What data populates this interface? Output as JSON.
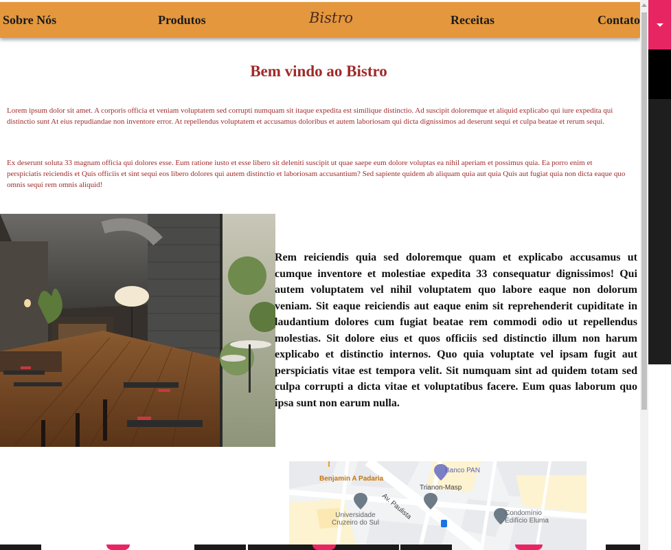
{
  "nav": {
    "items": [
      "Sobre Nós",
      "Produtos",
      "Receitas",
      "Contato"
    ],
    "logo": "Bistro"
  },
  "main": {
    "title": "Bem vindo ao Bistro",
    "paragraphs": [
      "Lorem ipsum dolor sit amet. A corporis officia et veniam voluptatem sed corrupti numquam sit itaque expedita est similique distinctio. Ad suscipit doloremque et aliquid explicabo qui iure expedita qui distinctio sunt At eius repudiandae non inventore error. At repellendus voluptatem et accusamus doloribus et autem laboriosam qui dicta dignissimos ad deserunt sequi et culpa beatae et rerum sequi.",
      "Ex deserunt soluta 33 magnam officia qui dolores esse. Eum ratione iusto et esse libero sit deleniti suscipit ut quae saepe eum dolore voluptas ea nihil aperiam et possimus quia. Ea porro enim et perspiciatis reiciendis et Quis officiis et sint sequi eos libero dolores qui autem distinctio et laboriosam accusantium? Sed sapiente quidem ab aliquam quia aut quia Quis aut fugiat quia non dicta eaque quo omnis sequi rem omnis aliquid!"
    ],
    "side_text": "Rem reiciendis quia sed doloremque quam et explicabo accusamus ut cumque inventore et molestiae expedita 33 consequatur dignissimos! Qui autem voluptatem vel nihil voluptatem quo labore eaque non dolorum veniam. Sit eaque reiciendis aut eaque enim sit reprehenderit cupiditate in laudantium dolores cum fugiat beatae rem commodi odio ut repellendus molestias. Sit dolore eius et quos officiis sed distinctio illum non harum explicabo et distinctio internos. Quo quia voluptate vel ipsam fugit aut perspiciatis vitae est tempora velit. Sit numquam sint ad quidem totam sed culpa corrupti a dicta vitae et voluptatibus facere. Eum quas laborum quo ipsa sunt non earum nulla."
  },
  "map": {
    "labels": {
      "padaria": "Benjamin A Padaria",
      "banco": "Banco PAN",
      "metro": "Trianon-Masp",
      "avenida": "Av. Paulista",
      "universidade": "Universidade\nCruzeiro do Sul",
      "condominio": "Condomínio\nEdifício Eluma"
    }
  },
  "colors": {
    "navbar": "#e4973c",
    "title": "#a02a2a",
    "accent_pink": "#e82563"
  }
}
